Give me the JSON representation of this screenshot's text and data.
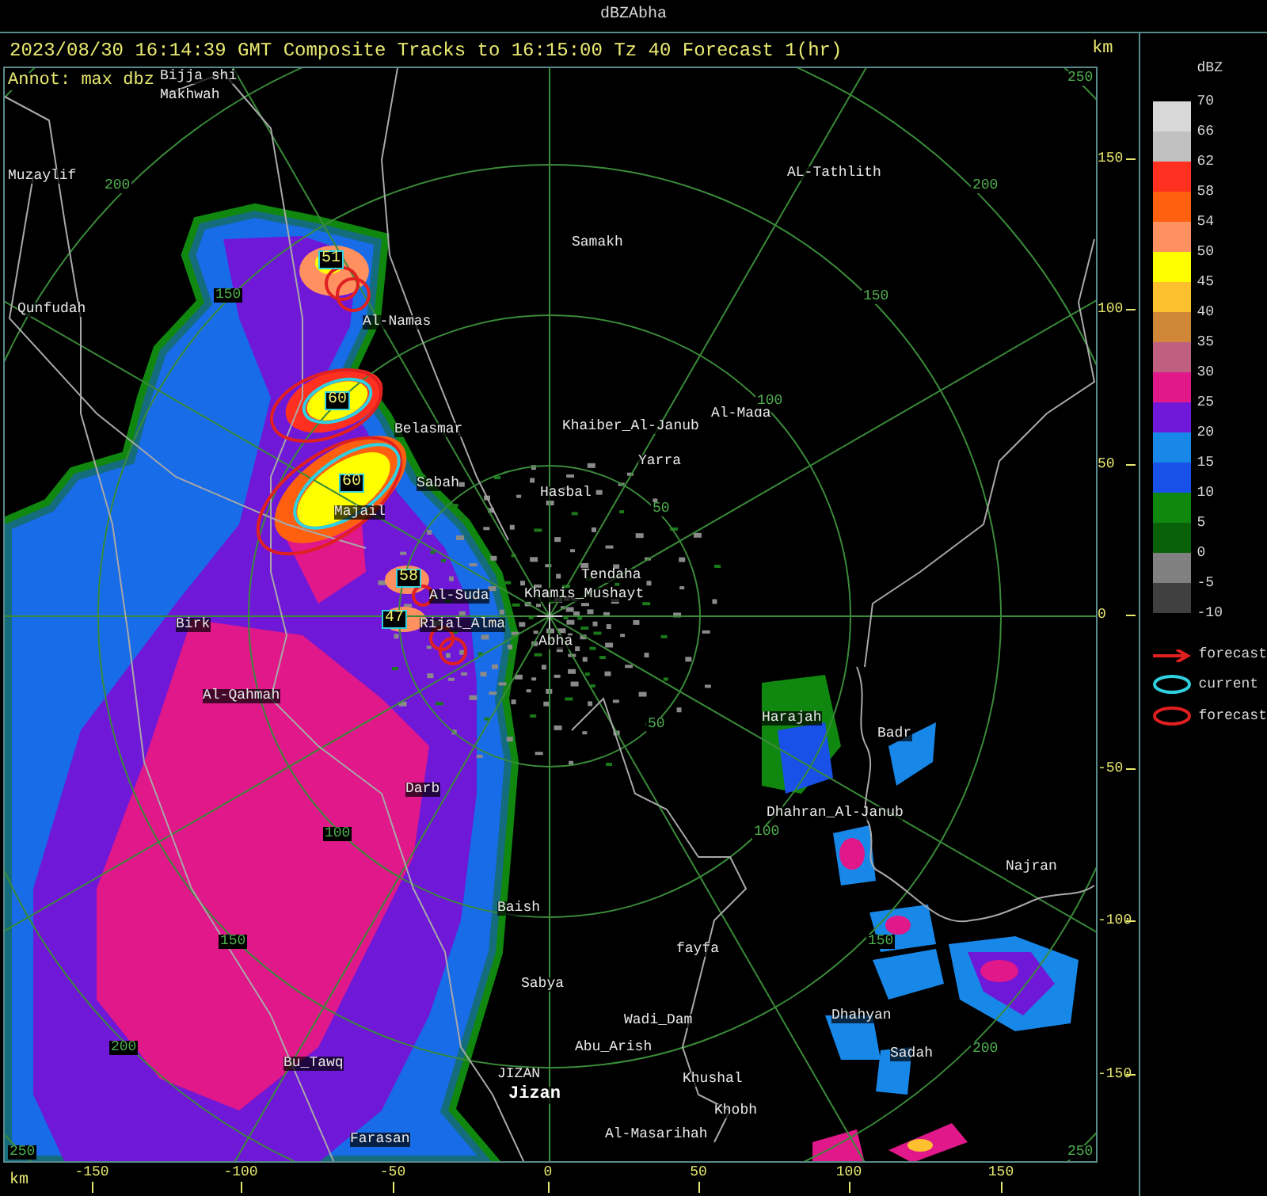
{
  "window": {
    "title": "dBZAbha"
  },
  "header": {
    "title": "2023/08/30 16:14:39 GMT Composite Tracks to 16:15:00 Tz 40 Forecast 1(hr)",
    "unit": "km"
  },
  "map": {
    "annotation": "Annot: max dbz",
    "places": [
      {
        "name": "Bijja shi",
        "kind": "town"
      },
      {
        "name": "Makhwah",
        "kind": "town"
      },
      {
        "name": "Muzaylif",
        "kind": "town"
      },
      {
        "name": "Qunfudah",
        "kind": "town"
      },
      {
        "name": "AL-Tathlith",
        "kind": "town"
      },
      {
        "name": "Samakh",
        "kind": "town"
      },
      {
        "name": "Al-Namas",
        "kind": "town"
      },
      {
        "name": "Khaiber_Al-Janub",
        "kind": "town"
      },
      {
        "name": "Al-Mada",
        "kind": "town"
      },
      {
        "name": "Belasmar",
        "kind": "town"
      },
      {
        "name": "Yarra",
        "kind": "town"
      },
      {
        "name": "Sabah",
        "kind": "town"
      },
      {
        "name": "Hasbal",
        "kind": "town"
      },
      {
        "name": "Majail",
        "kind": "town"
      },
      {
        "name": "Tendaha",
        "kind": "town"
      },
      {
        "name": "Al-Suda",
        "kind": "town"
      },
      {
        "name": "Khamis_Mushayt",
        "kind": "town"
      },
      {
        "name": "Rijal_Alma",
        "kind": "town"
      },
      {
        "name": "Abha",
        "kind": "town"
      },
      {
        "name": "Birk",
        "kind": "town"
      },
      {
        "name": "Al-Qahmah",
        "kind": "town"
      },
      {
        "name": "Darb",
        "kind": "town"
      },
      {
        "name": "Harajah",
        "kind": "town"
      },
      {
        "name": "Badr",
        "kind": "town"
      },
      {
        "name": "Dhahran_Al-Janub",
        "kind": "town"
      },
      {
        "name": "Najran",
        "kind": "town"
      },
      {
        "name": "Baish",
        "kind": "town"
      },
      {
        "name": "fayfa",
        "kind": "town"
      },
      {
        "name": "Sabya",
        "kind": "town"
      },
      {
        "name": "Wadi_Dam",
        "kind": "town"
      },
      {
        "name": "Dhahyan",
        "kind": "town"
      },
      {
        "name": "Abu_Arish",
        "kind": "town"
      },
      {
        "name": "Sadah",
        "kind": "town"
      },
      {
        "name": "Bu_Tawq",
        "kind": "town"
      },
      {
        "name": "JIZAN",
        "kind": "town"
      },
      {
        "name": "Khushal",
        "kind": "town"
      },
      {
        "name": "Jizan",
        "kind": "city"
      },
      {
        "name": "Khobh",
        "kind": "town"
      },
      {
        "name": "Al-Masarihah",
        "kind": "town"
      },
      {
        "name": "Farasan",
        "kind": "town"
      }
    ],
    "range_labels": [
      "250",
      "200",
      "200",
      "150",
      "150",
      "100",
      "50",
      "50",
      "100",
      "100",
      "150",
      "150",
      "200",
      "200",
      "250",
      "250"
    ],
    "storm_cells": [
      {
        "label": "51"
      },
      {
        "label": "60"
      },
      {
        "label": "60"
      },
      {
        "label": "58"
      },
      {
        "label": "47"
      }
    ]
  },
  "y_axis": {
    "ticks": [
      "150",
      "100",
      "50",
      "0",
      "-50",
      "-100",
      "-150"
    ]
  },
  "x_axis": {
    "unit": "km",
    "ticks": [
      "-150",
      "-100",
      "-50",
      "0",
      "50",
      "100",
      "150"
    ]
  },
  "legend": {
    "title": "dBZ",
    "labels": [
      "70",
      "66",
      "62",
      "58",
      "54",
      "50",
      "45",
      "40",
      "35",
      "30",
      "25",
      "20",
      "15",
      "10",
      "5",
      "0",
      "-5",
      "-10"
    ],
    "bands": [
      {
        "color": "#d8d8d8"
      },
      {
        "color": "#c0c0c0"
      },
      {
        "color": "#ff3020"
      },
      {
        "color": "#ff6010"
      },
      {
        "color": "#ff9060"
      },
      {
        "color": "#ffff00"
      },
      {
        "color": "#ffc030"
      },
      {
        "color": "#d08838"
      },
      {
        "color": "#c06080"
      },
      {
        "color": "#e0188a"
      },
      {
        "color": "#7018d8"
      },
      {
        "color": "#1888e8"
      },
      {
        "color": "#1850e8"
      },
      {
        "color": "#108810"
      },
      {
        "color": "#086008"
      },
      {
        "color": "#808080"
      },
      {
        "color": "#404040"
      }
    ],
    "symbols": [
      {
        "kind": "arrow",
        "color": "#e02020",
        "label": "forecast"
      },
      {
        "kind": "ellipse",
        "color": "#30d0e0",
        "label": "current"
      },
      {
        "kind": "ellipse",
        "color": "#e02020",
        "label": "forecast"
      }
    ]
  }
}
